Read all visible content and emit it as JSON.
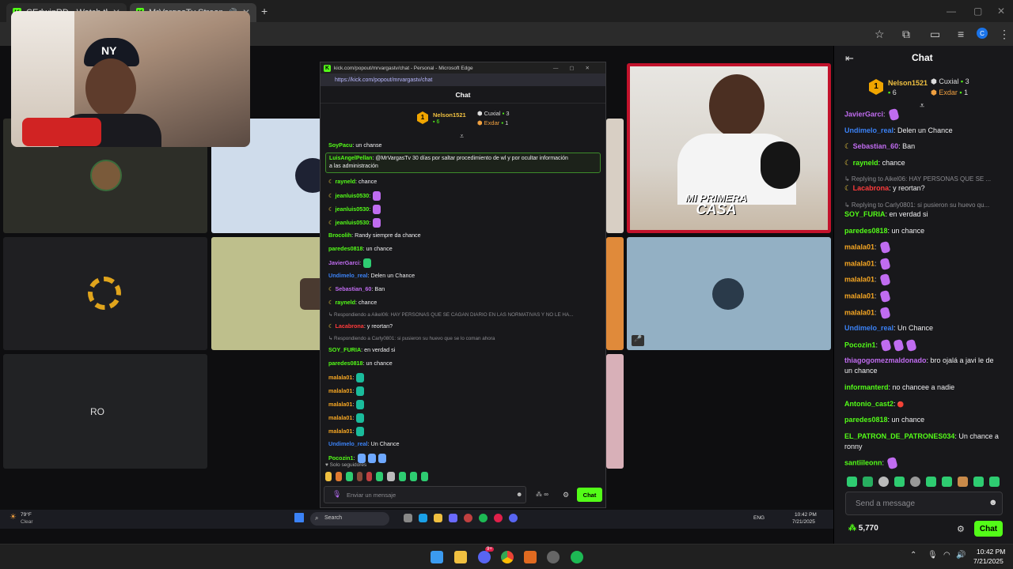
{
  "browser": {
    "tabs": [
      {
        "title": "CEdwinRD - Watch the VOD on"
      },
      {
        "title": "MrVargasTv Stream - Watch"
      }
    ],
    "new_tab": "+"
  },
  "popout": {
    "window_title": "kick.com/popout/mrvargastv/chat - Personal - Microsoft Edge",
    "url": "https://kick.com/popout/mrvargastv/chat",
    "header": "Chat",
    "gifters": [
      {
        "name": "Nelson1521",
        "count": "6",
        "rank": "1"
      },
      {
        "name": "Cuxial",
        "count": "3"
      },
      {
        "name": "Exdar",
        "count": "1"
      }
    ],
    "pinned": {
      "user": "LuisAngelPellan",
      "text": ": @MrVargasTv 30 días por saltar procedimiento de wl y por ocultar información",
      "text2": "a las administración"
    },
    "messages": [
      {
        "user": "SoyPacu",
        "text": ": un chanse",
        "color": "#53fc18"
      },
      {
        "user": "rayneld",
        "text": ": chance",
        "color": "#53fc18",
        "badge": true
      },
      {
        "user": "jeanluis0530",
        "text": ":",
        "color": "#53fc18",
        "badge": true,
        "emote": "#c06cf0"
      },
      {
        "user": "jeanluis0530",
        "text": ":",
        "color": "#53fc18",
        "badge": true,
        "emote": "#c06cf0"
      },
      {
        "user": "jeanluis0530",
        "text": ":",
        "color": "#53fc18",
        "badge": true,
        "emote": "#c06cf0"
      },
      {
        "user": "Brocolih",
        "text": ": Randy siempre da chance",
        "color": "#53fc18"
      },
      {
        "user": "paredes0818",
        "text": ": un chance",
        "color": "#53fc18"
      },
      {
        "user": "JavierGarci",
        "text": ":",
        "color": "#c06cf0",
        "emote": "#2ecc71"
      },
      {
        "user": "Undimelo_real",
        "text": ": Delen un Chance",
        "color": "#3b82f6"
      },
      {
        "user": "Sebastian_60",
        "text": ": Ban",
        "color": "#c06cf0",
        "badge": true
      },
      {
        "user": "rayneld",
        "text": ": chance",
        "color": "#53fc18",
        "badge": true
      },
      {
        "reply": "Respondiendo a Aikel06: HAY PERSONAS QUE SE CAGAN DIARIO EN LAS NORMATIVAS Y NO LE HA..."
      },
      {
        "user": "Lacabrona",
        "text": ": y reortan?",
        "color": "#ff3b3b",
        "badge": true
      },
      {
        "reply": "Respondiendo a Carly0801: si pusieron su huevo que se lo coman ahora"
      },
      {
        "user": "SOY_FURIA",
        "text": ": en verdad si",
        "color": "#53fc18"
      },
      {
        "user": "paredes0818",
        "text": ": un chance",
        "color": "#53fc18"
      },
      {
        "user": "malala01",
        "text": ":",
        "color": "#f5a623",
        "emote": "#1abc9c"
      },
      {
        "user": "malala01",
        "text": ":",
        "color": "#f5a623",
        "emote": "#1abc9c"
      },
      {
        "user": "malala01",
        "text": ":",
        "color": "#f5a623",
        "emote": "#1abc9c"
      },
      {
        "user": "malala01",
        "text": ":",
        "color": "#f5a623",
        "emote": "#1abc9c"
      },
      {
        "user": "malala01",
        "text": ":",
        "color": "#f5a623",
        "emote": "#1abc9c"
      },
      {
        "user": "Undimelo_real",
        "text": ": Un Chance",
        "color": "#3b82f6"
      },
      {
        "user": "Pocozin1",
        "text": ":",
        "color": "#53fc18",
        "emote": "#6ea8ff",
        "emotes": 3
      }
    ],
    "followers_only": "Solo seguidores",
    "input_placeholder": "Enviar un mensaje",
    "points": "∞",
    "send": "Chat"
  },
  "chat": {
    "title": "Chat",
    "gifters": [
      {
        "name": "Nelson1521",
        "count": "6",
        "rank": "1"
      },
      {
        "name": "Cuxial",
        "count": "3"
      },
      {
        "name": "Exdar",
        "count": "1"
      }
    ],
    "messages": [
      {
        "user": "JavierGarci",
        "text": ":",
        "color": "#c06cf0",
        "emote": true
      },
      {
        "user": "Undimelo_real",
        "text": ": Delen un Chance",
        "color": "#3b82f6"
      },
      {
        "user": "Sebastian_60",
        "text": ": Ban",
        "color": "#c06cf0",
        "badge": true
      },
      {
        "user": "rayneld",
        "text": ": chance",
        "color": "#53fc18",
        "badge": true
      },
      {
        "reply": "Replying to Aikel06: HAY PERSONAS QUE SE ..."
      },
      {
        "user": "Lacabrona",
        "text": ": y reortan?",
        "color": "#ff3b3b",
        "badge": true
      },
      {
        "reply": "Replying to Carly0801: si pusieron su huevo qu..."
      },
      {
        "user": "SOY_FURIA",
        "text": ": en verdad si",
        "color": "#53fc18"
      },
      {
        "user": "paredes0818",
        "text": ": un chance",
        "color": "#53fc18"
      },
      {
        "user": "malala01",
        "text": ":",
        "color": "#f5a623",
        "emote": true
      },
      {
        "user": "malala01",
        "text": ":",
        "color": "#f5a623",
        "emote": true
      },
      {
        "user": "malala01",
        "text": ":",
        "color": "#f5a623",
        "emote": true
      },
      {
        "user": "malala01",
        "text": ":",
        "color": "#f5a623",
        "emote": true
      },
      {
        "user": "malala01",
        "text": ":",
        "color": "#f5a623",
        "emote": true
      },
      {
        "user": "Undimelo_real",
        "text": ": Un Chance",
        "color": "#3b82f6"
      },
      {
        "user": "Pocozin1",
        "text": ":",
        "color": "#53fc18",
        "emote": true,
        "emotes": 3
      },
      {
        "user": "thiagogomezmaldonado",
        "text": ": bro ojalá a javi le de",
        "text2": "un chance",
        "color": "#c06cf0"
      },
      {
        "user": "informanterd",
        "text": ": no chancee a nadie",
        "color": "#53fc18"
      },
      {
        "user": "Antonio_cast2",
        "text": ":",
        "color": "#53fc18",
        "tag": "🔴"
      },
      {
        "user": "paredes0818",
        "text": ": un chance",
        "color": "#53fc18"
      },
      {
        "user": "EL_PATRON_DE_PATRONES034",
        "text": ": Un chance a",
        "text2": "ronny",
        "color": "#53fc18"
      },
      {
        "user": "santiileonn",
        "text": ":",
        "color": "#53fc18",
        "emote": true
      }
    ],
    "input_placeholder": "Send a message",
    "points": "5,770",
    "send": "Chat"
  },
  "inner_taskbar": {
    "weather_temp": "79°F",
    "weather_desc": "Clear",
    "search": "Search",
    "lang": "ENG",
    "time": "10:42 PM",
    "date": "7/21/2025"
  },
  "taskbar": {
    "time": "10:42 PM",
    "date": "7/21/2025",
    "discord_badge": "9+"
  },
  "overlay": {
    "logo_line1": "MI PRIMERA",
    "logo_line2": "CASA",
    "ro_text": "RO"
  }
}
